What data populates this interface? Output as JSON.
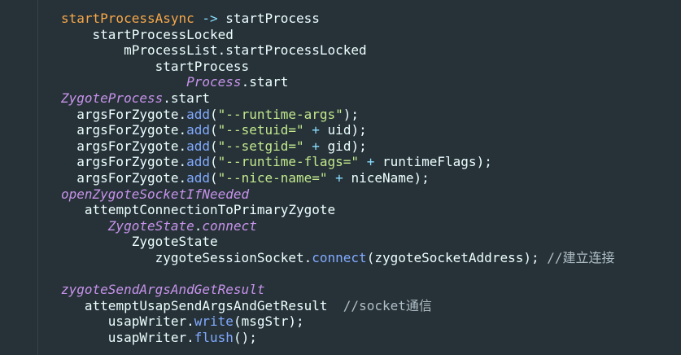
{
  "editor": {
    "theme_colors": {
      "background": "#263238",
      "text": "#eeffff",
      "orange": "#f9a748",
      "purple": "#c792ea",
      "method_blue": "#82aaff",
      "string_green": "#c3e88d",
      "operator_cyan": "#89ddff",
      "comment_grey": "#b0bec5"
    },
    "lines": [
      {
        "indent": 0,
        "tokens": [
          {
            "t": "startProcessAsync",
            "k": "fn-orange"
          },
          {
            "t": " -> ",
            "k": "arrow"
          },
          {
            "t": "startProcess",
            "k": "plain"
          }
        ]
      },
      {
        "indent": 4,
        "tokens": [
          {
            "t": "startProcessLocked",
            "k": "plain"
          }
        ]
      },
      {
        "indent": 8,
        "tokens": [
          {
            "t": "mProcessList.startProcessLocked",
            "k": "plain"
          }
        ]
      },
      {
        "indent": 12,
        "tokens": [
          {
            "t": "startProcess",
            "k": "plain"
          }
        ]
      },
      {
        "indent": 16,
        "tokens": [
          {
            "t": "Process",
            "k": "italic-purple"
          },
          {
            "t": ".start",
            "k": "plain"
          }
        ]
      },
      {
        "indent": 0,
        "tokens": [
          {
            "t": "ZygoteProcess",
            "k": "italic-purple"
          },
          {
            "t": ".start",
            "k": "plain"
          }
        ]
      },
      {
        "indent": 2,
        "tokens": [
          {
            "t": "argsForZygote.",
            "k": "plain"
          },
          {
            "t": "add",
            "k": "method"
          },
          {
            "t": "(",
            "k": "punct"
          },
          {
            "t": "\"--runtime-args\"",
            "k": "string"
          },
          {
            "t": ");",
            "k": "punct"
          }
        ]
      },
      {
        "indent": 2,
        "tokens": [
          {
            "t": "argsForZygote.",
            "k": "plain"
          },
          {
            "t": "add",
            "k": "method"
          },
          {
            "t": "(",
            "k": "punct"
          },
          {
            "t": "\"--setuid=\"",
            "k": "string"
          },
          {
            "t": " + ",
            "k": "op"
          },
          {
            "t": "uid);",
            "k": "plain"
          }
        ]
      },
      {
        "indent": 2,
        "tokens": [
          {
            "t": "argsForZygote.",
            "k": "plain"
          },
          {
            "t": "add",
            "k": "method"
          },
          {
            "t": "(",
            "k": "punct"
          },
          {
            "t": "\"--setgid=\"",
            "k": "string"
          },
          {
            "t": " + ",
            "k": "op"
          },
          {
            "t": "gid);",
            "k": "plain"
          }
        ]
      },
      {
        "indent": 2,
        "tokens": [
          {
            "t": "argsForZygote.",
            "k": "plain"
          },
          {
            "t": "add",
            "k": "method"
          },
          {
            "t": "(",
            "k": "punct"
          },
          {
            "t": "\"--runtime-flags=\"",
            "k": "string"
          },
          {
            "t": " + ",
            "k": "op"
          },
          {
            "t": "runtimeFlags);",
            "k": "plain"
          }
        ]
      },
      {
        "indent": 2,
        "tokens": [
          {
            "t": "argsForZygote.",
            "k": "plain"
          },
          {
            "t": "add",
            "k": "method"
          },
          {
            "t": "(",
            "k": "punct"
          },
          {
            "t": "\"--nice-name=\"",
            "k": "string"
          },
          {
            "t": " + ",
            "k": "op"
          },
          {
            "t": "niceName);",
            "k": "plain"
          }
        ]
      },
      {
        "indent": 0,
        "tokens": [
          {
            "t": "openZygoteSocketIfNeeded",
            "k": "italic-purple"
          }
        ]
      },
      {
        "indent": 3,
        "tokens": [
          {
            "t": "attemptConnectionToPrimaryZygote",
            "k": "plain"
          }
        ]
      },
      {
        "indent": 6,
        "tokens": [
          {
            "t": "ZygoteState",
            "k": "italic-purple"
          },
          {
            "t": ".",
            "k": "plain"
          },
          {
            "t": "connect",
            "k": "italic-purple"
          }
        ]
      },
      {
        "indent": 9,
        "tokens": [
          {
            "t": "ZygoteState",
            "k": "plain"
          }
        ]
      },
      {
        "indent": 12,
        "tokens": [
          {
            "t": "zygoteSessionSocket.",
            "k": "plain"
          },
          {
            "t": "connect",
            "k": "method"
          },
          {
            "t": "(zygoteSocketAddress); ",
            "k": "plain"
          },
          {
            "t": "//建立连接",
            "k": "comment"
          }
        ]
      },
      {
        "indent": 0,
        "blank": true,
        "tokens": []
      },
      {
        "indent": 0,
        "tokens": [
          {
            "t": "zygoteSendArgsAndGetResult",
            "k": "italic-purple"
          }
        ]
      },
      {
        "indent": 3,
        "tokens": [
          {
            "t": "attemptUsapSendArgsAndGetResult  ",
            "k": "plain"
          },
          {
            "t": "//socket通信",
            "k": "comment"
          }
        ]
      },
      {
        "indent": 6,
        "tokens": [
          {
            "t": "usapWriter.",
            "k": "plain"
          },
          {
            "t": "write",
            "k": "method"
          },
          {
            "t": "(msgStr);",
            "k": "plain"
          }
        ]
      },
      {
        "indent": 6,
        "tokens": [
          {
            "t": "usapWriter.",
            "k": "plain"
          },
          {
            "t": "flush",
            "k": "method"
          },
          {
            "t": "();",
            "k": "plain"
          }
        ]
      }
    ]
  }
}
